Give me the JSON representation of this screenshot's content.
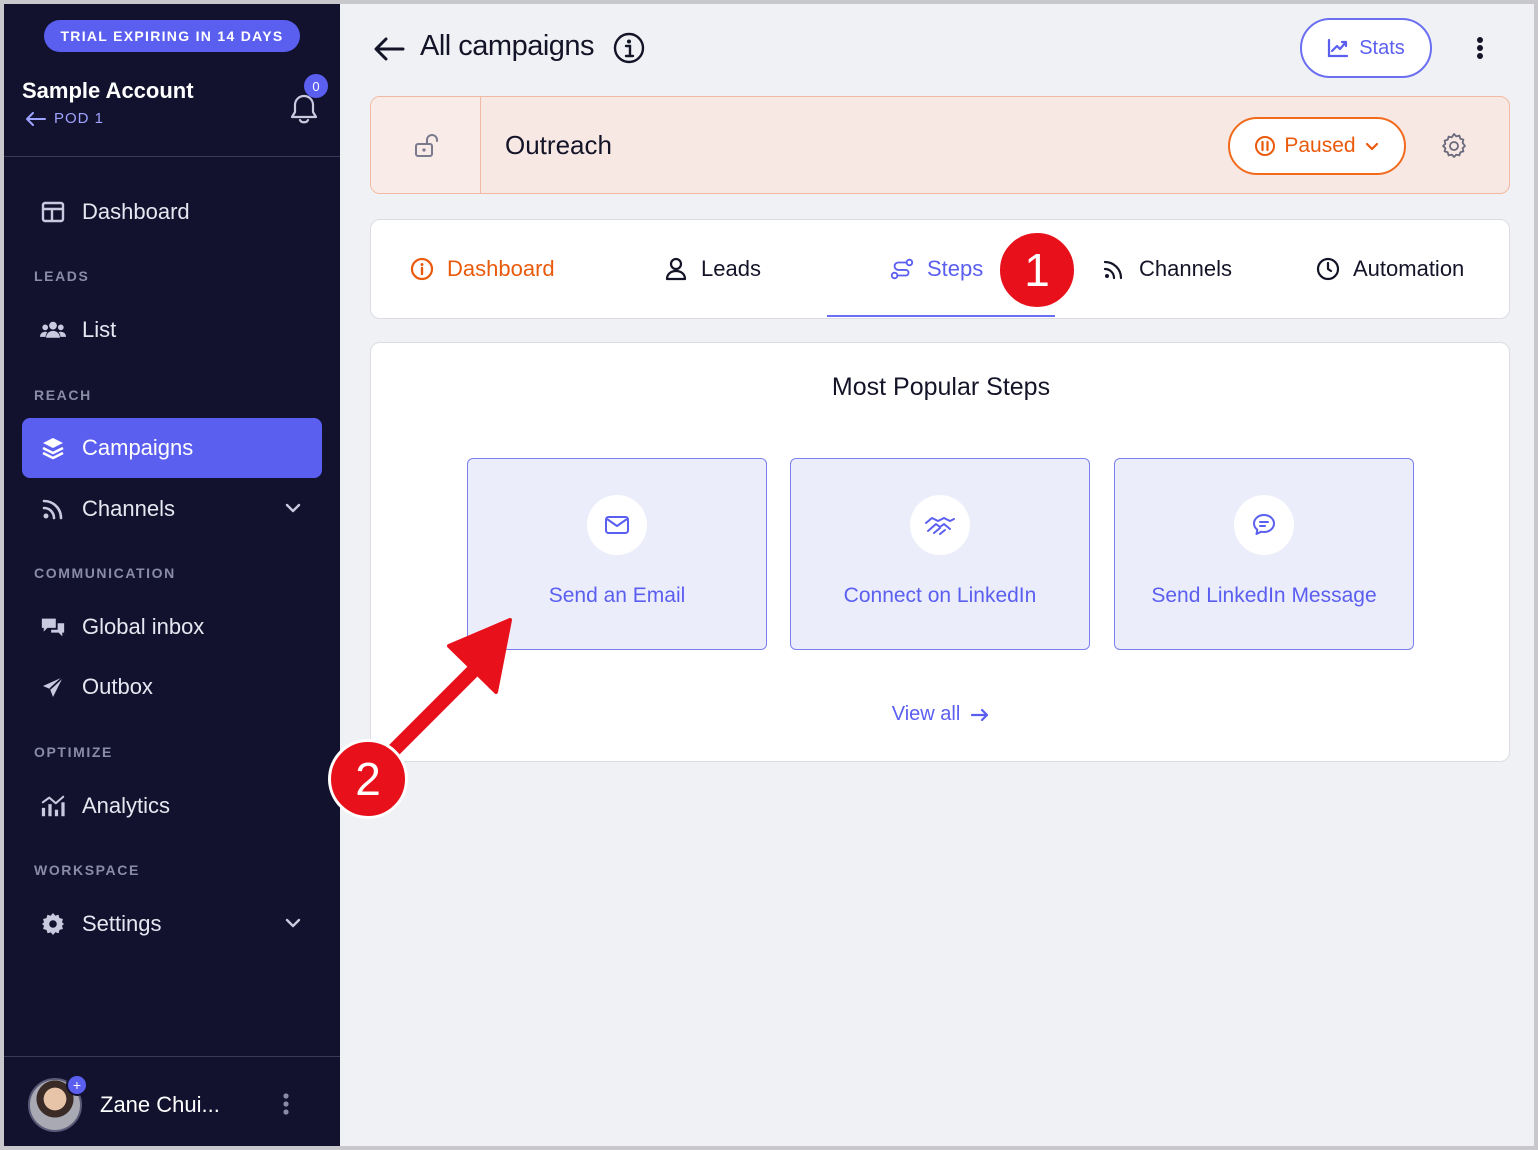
{
  "sidebar": {
    "trial_banner": "TRIAL EXPIRING IN 14 DAYS",
    "account_name": "Sample Account",
    "pod_label": "POD 1",
    "notification_count": "0",
    "sections": {
      "leads": "LEADS",
      "reach": "REACH",
      "communication": "COMMUNICATION",
      "optimize": "OPTIMIZE",
      "workspace": "WORKSPACE"
    },
    "items": {
      "dashboard": "Dashboard",
      "list": "List",
      "campaigns": "Campaigns",
      "channels": "Channels",
      "global_inbox": "Global inbox",
      "outbox": "Outbox",
      "analytics": "Analytics",
      "settings": "Settings"
    },
    "active_item": "Campaigns",
    "user_name": "Zane Chui..."
  },
  "header": {
    "title": "All campaigns",
    "stats_label": "Stats"
  },
  "campaign": {
    "name": "Outreach",
    "status": "Paused"
  },
  "tabs": [
    {
      "label": "Dashboard",
      "icon": "info-circle-icon"
    },
    {
      "label": "Leads",
      "icon": "user-icon"
    },
    {
      "label": "Steps",
      "icon": "steps-icon"
    },
    {
      "label": "Channels",
      "icon": "rss-icon"
    },
    {
      "label": "Automation",
      "icon": "clock-icon"
    }
  ],
  "active_tab": "Steps",
  "steps": {
    "title": "Most Popular Steps",
    "items": [
      {
        "label": "Send an Email",
        "icon": "envelope-icon"
      },
      {
        "label": "Connect on LinkedIn",
        "icon": "handshake-icon"
      },
      {
        "label": "Send LinkedIn Message",
        "icon": "chat-icon"
      }
    ],
    "view_all": "View all"
  },
  "annotations": {
    "badge_1": "1",
    "badge_2": "2"
  },
  "colors": {
    "sidebar_bg": "#12122e",
    "accent": "#5b5ff0",
    "paused_orange": "#ea5a0c",
    "annotation_red": "#e8101a"
  }
}
